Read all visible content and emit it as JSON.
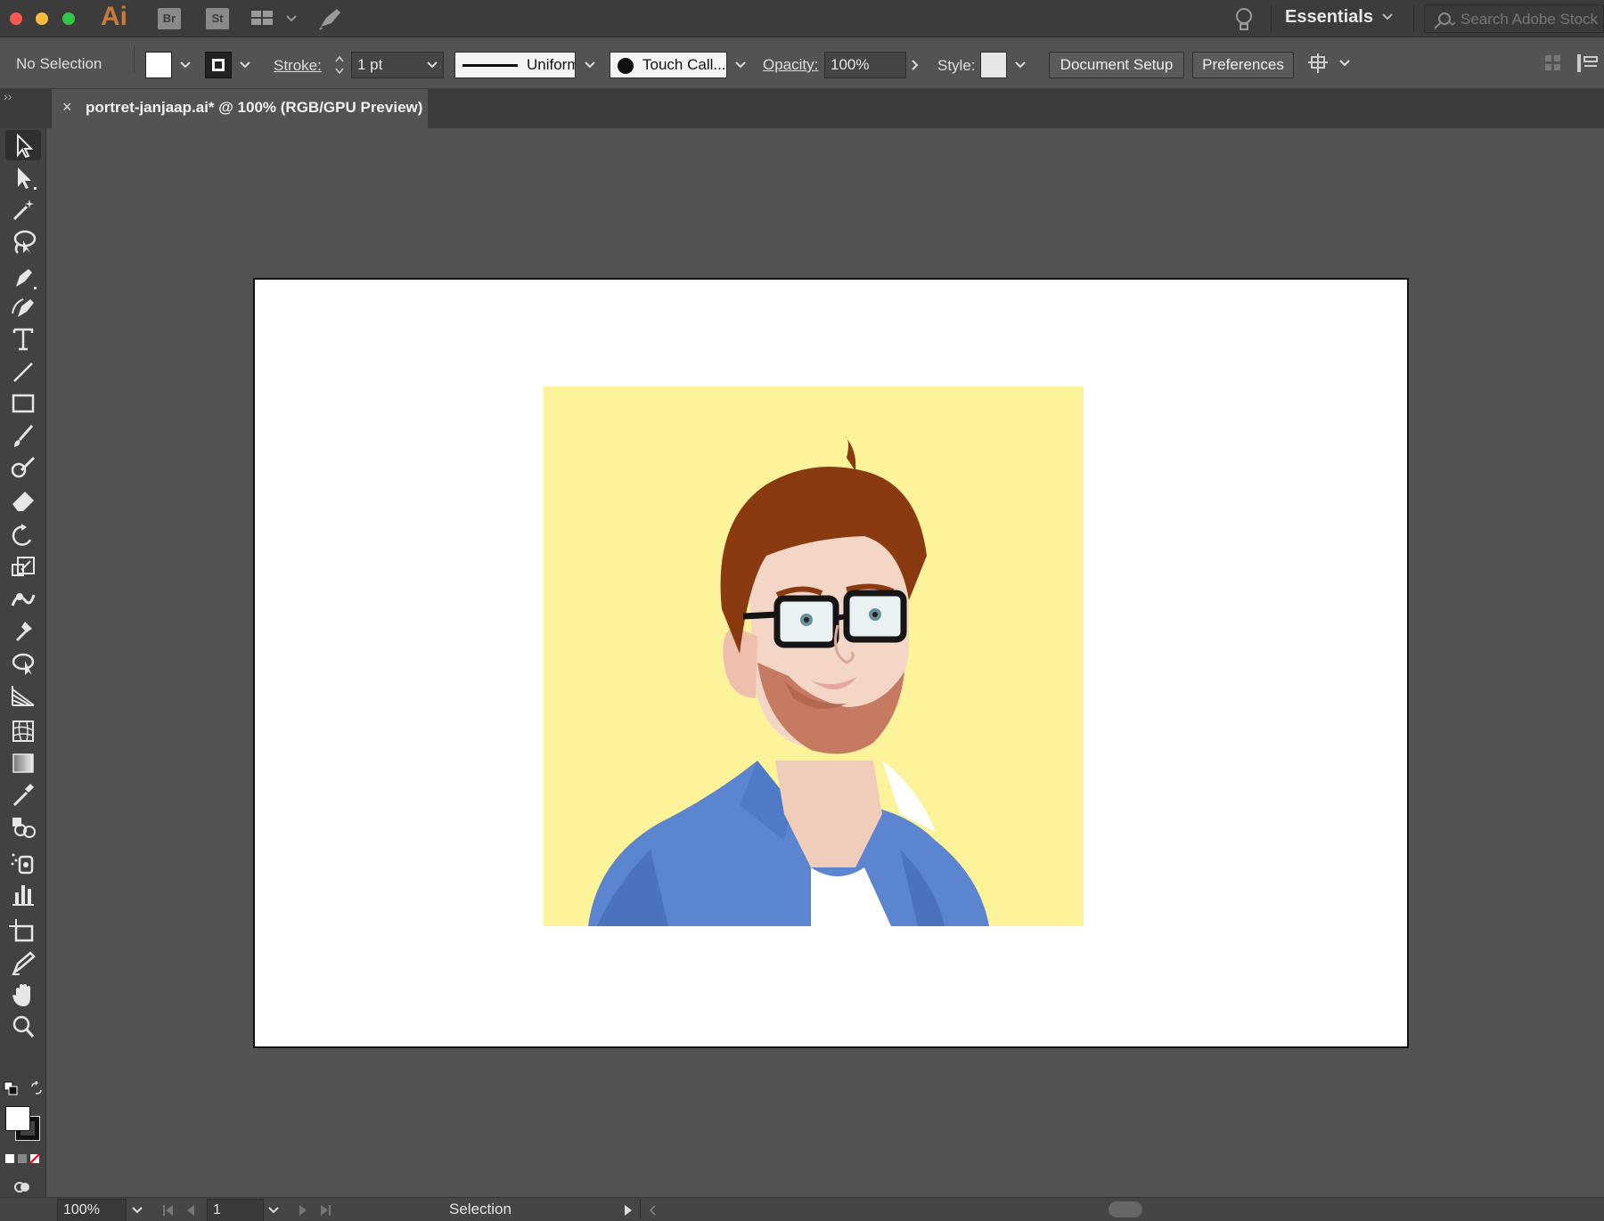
{
  "app": {
    "logo": "Ai",
    "bridge_badge": "Br",
    "stock_badge": "St",
    "workspace": "Essentials",
    "search_placeholder": "Search Adobe Stock"
  },
  "control_bar": {
    "selection_status": "No Selection",
    "stroke_label": "Stroke:",
    "stroke_weight": "1 pt",
    "profile": "Uniform",
    "brush": "Touch Call...",
    "opacity_label": "Opacity:",
    "opacity_value": "100%",
    "style_label": "Style:",
    "document_setup": "Document Setup",
    "preferences": "Preferences"
  },
  "document_tab": {
    "close": "×",
    "title": "portret-janjaap.ai* @ 100% (RGB/GPU Preview)"
  },
  "tools": [
    "selection-tool-icon",
    "direct-selection-tool-icon",
    "magic-wand-icon",
    "lasso-icon",
    "pen-tool-icon",
    "curvature-tool-icon",
    "type-tool-icon",
    "line-segment-icon",
    "rectangle-tool-icon",
    "paintbrush-icon",
    "shaper-tool-icon",
    "eraser-icon",
    "rotate-tool-icon",
    "scale-tool-icon",
    "warp-tool-icon",
    "puppet-warp-icon",
    "free-transform-icon",
    "perspective-grid-icon",
    "mesh-tool-icon",
    "gradient-tool-icon",
    "eyedropper-icon",
    "blend-tool-icon",
    "symbol-sprayer-icon",
    "column-graph-icon",
    "artboard-tool-icon",
    "slice-tool-icon",
    "hand-tool-icon",
    "zoom-tool-icon"
  ],
  "status_bar": {
    "zoom": "100%",
    "artboard_number": "1",
    "tool_name": "Selection"
  },
  "colors": {
    "portrait_background": "#fdf39a",
    "shirt": "#5b86cf",
    "hair": "#8a3a10",
    "skin": "#f3d6c6"
  }
}
